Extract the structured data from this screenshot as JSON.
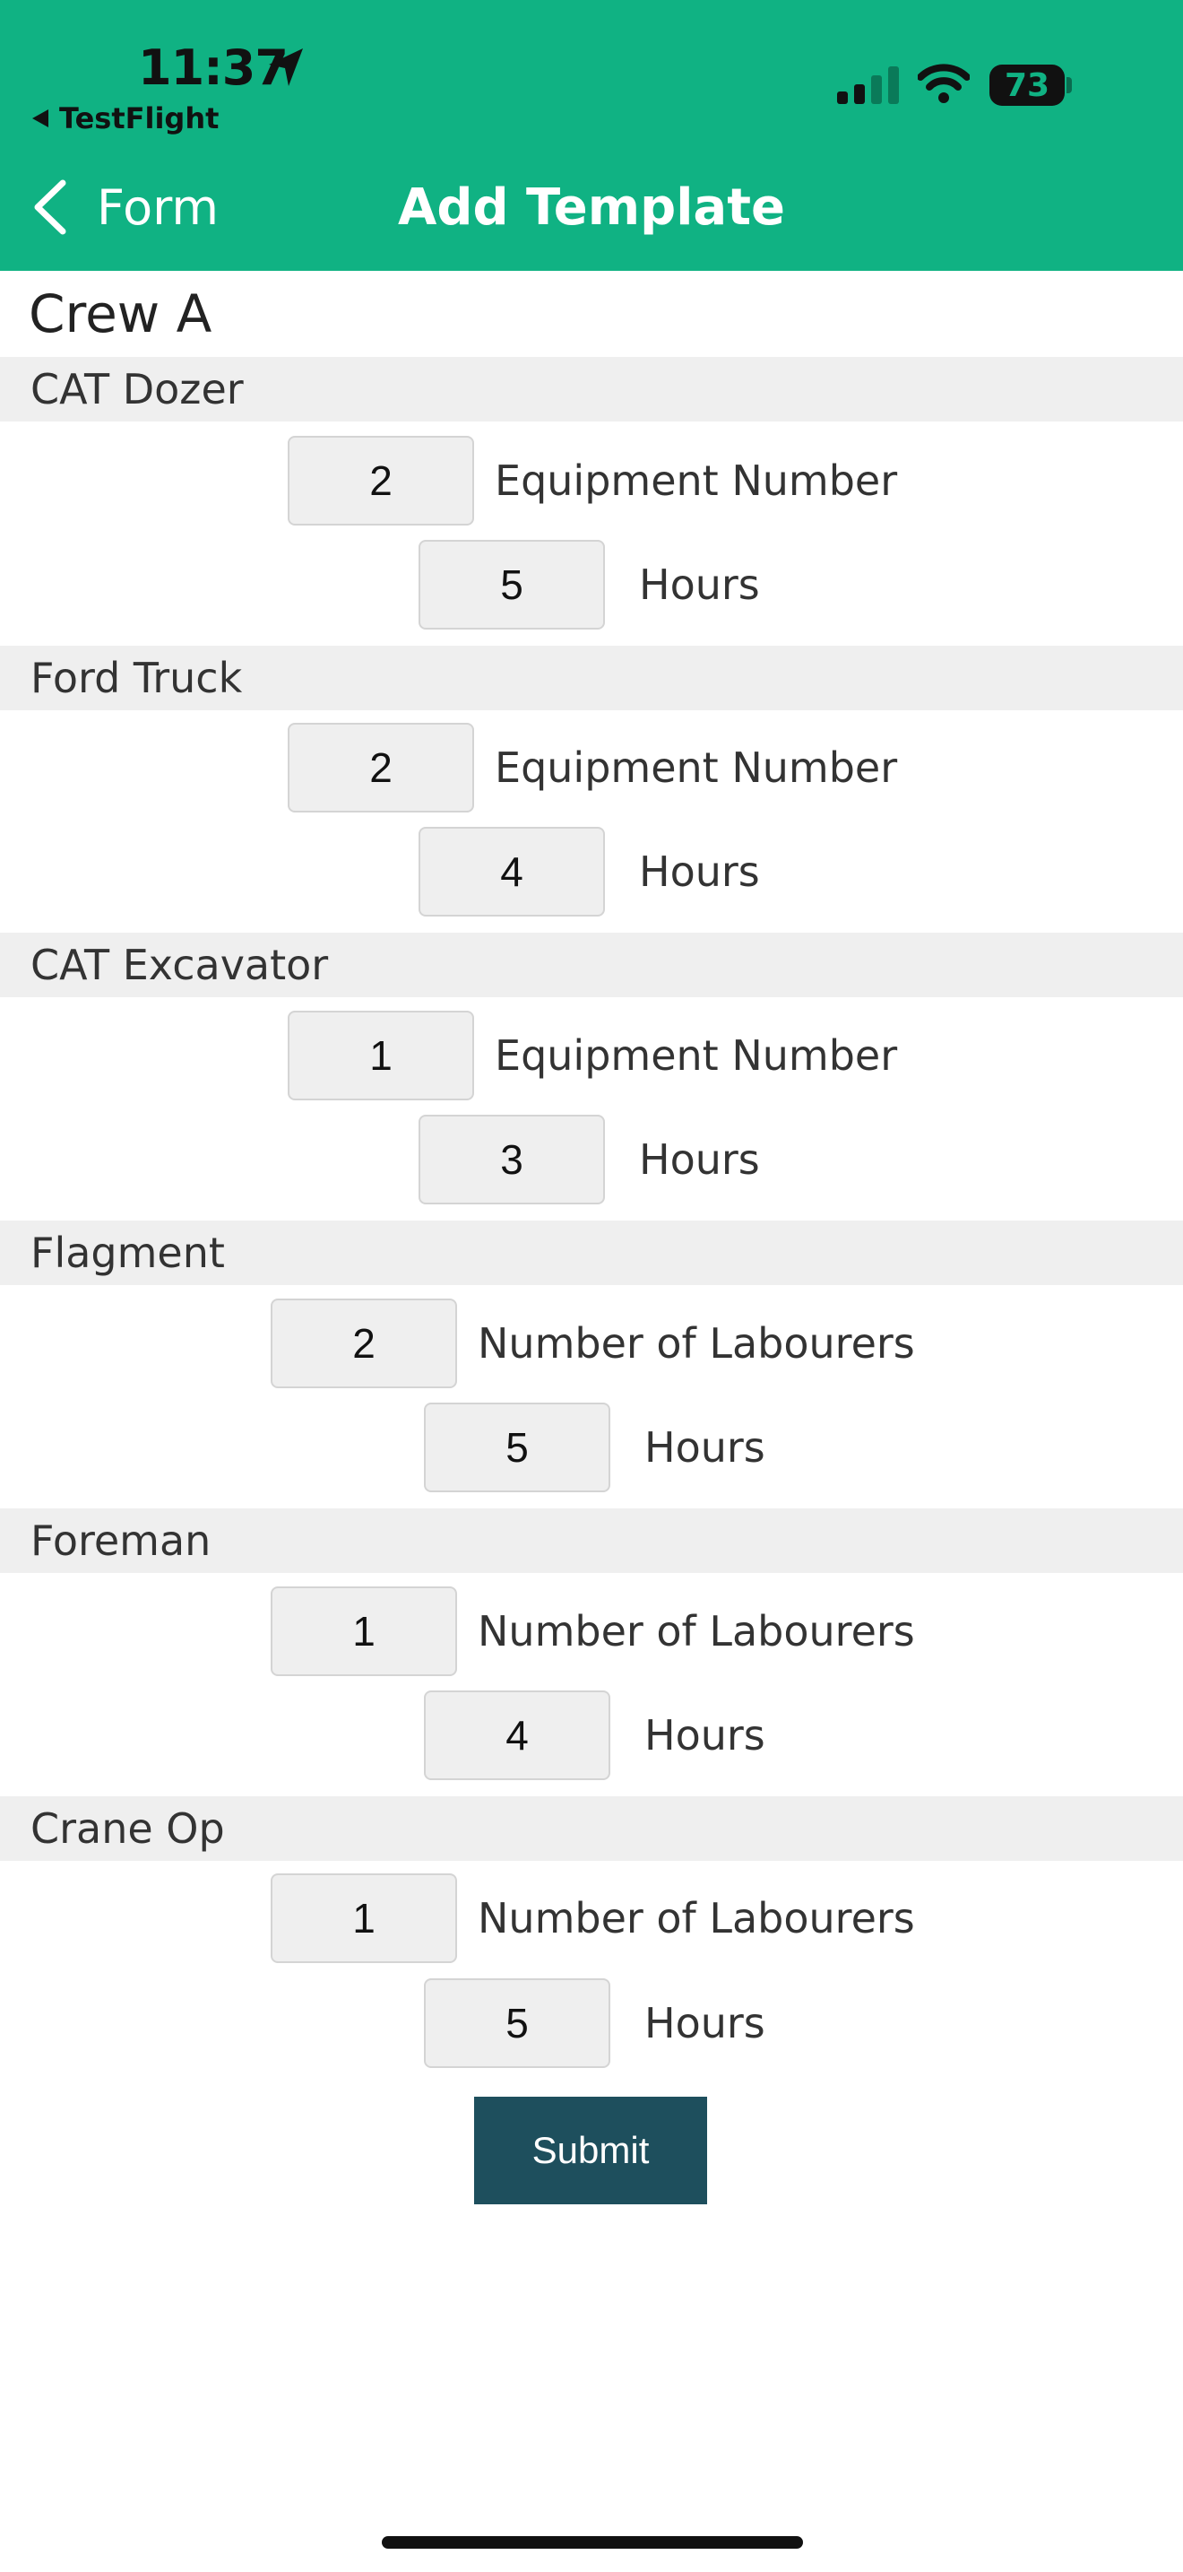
{
  "status_bar": {
    "time": "11:37",
    "back_app": "TestFlight",
    "battery": "73"
  },
  "nav": {
    "back_label": "Form",
    "title": "Add Template"
  },
  "crew": "Crew A",
  "sections": [
    {
      "name": "CAT Dozer",
      "count_label": "Equipment Number",
      "count_value": "2",
      "hours_label": "Hours",
      "hours_value": "5"
    },
    {
      "name": "Ford Truck",
      "count_label": "Equipment Number",
      "count_value": "2",
      "hours_label": "Hours",
      "hours_value": "4"
    },
    {
      "name": "CAT Excavator",
      "count_label": "Equipment Number",
      "count_value": "1",
      "hours_label": "Hours",
      "hours_value": "3"
    },
    {
      "name": "Flagment",
      "count_label": "Number of Labourers",
      "count_value": "2",
      "hours_label": "Hours",
      "hours_value": "5"
    },
    {
      "name": "Foreman",
      "count_label": "Number of Labourers",
      "count_value": "1",
      "hours_label": "Hours",
      "hours_value": "4"
    },
    {
      "name": "Crane Op",
      "count_label": "Number of Labourers",
      "count_value": "1",
      "hours_label": "Hours",
      "hours_value": "5"
    }
  ],
  "submit_label": "Submit",
  "colors": {
    "header": "#10b283",
    "submit": "#1e4f5d",
    "section_bg": "#efefef"
  }
}
